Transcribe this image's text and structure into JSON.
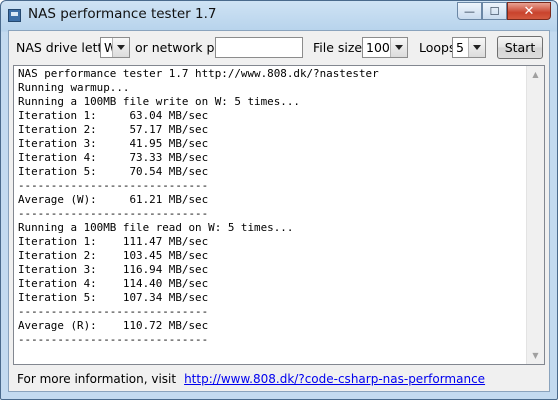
{
  "window": {
    "title": "NAS performance tester 1.7",
    "controls": {
      "minimize": "—",
      "maximize": "☐",
      "close": "✕"
    }
  },
  "toolbar": {
    "drive_label": "NAS drive letter",
    "drive_value": "W",
    "network_label": "or network path",
    "network_path_value": "",
    "filesize_label": "File size",
    "filesize_value": "100",
    "loops_label": "Loops",
    "loops_value": "5",
    "start_label": "Start"
  },
  "output": {
    "lines": [
      "NAS performance tester 1.7 http://www.808.dk/?nastester",
      "Running warmup...",
      "Running a 100MB file write on W: 5 times...",
      "Iteration 1:     63.04 MB/sec",
      "Iteration 2:     57.17 MB/sec",
      "Iteration 3:     41.95 MB/sec",
      "Iteration 4:     73.33 MB/sec",
      "Iteration 5:     70.54 MB/sec",
      "-----------------------------",
      "Average (W):     61.21 MB/sec",
      "-----------------------------",
      "Running a 100MB file read on W: 5 times...",
      "Iteration 1:    111.47 MB/sec",
      "Iteration 2:    103.45 MB/sec",
      "Iteration 3:    116.94 MB/sec",
      "Iteration 4:    114.40 MB/sec",
      "Iteration 5:    107.34 MB/sec",
      "-----------------------------",
      "Average (R):    110.72 MB/sec",
      "-----------------------------"
    ]
  },
  "footer": {
    "info_text": "For more information, visit",
    "link_text": "http://www.808.dk/?code-csharp-nas-performance"
  },
  "colors": {
    "link": "#0000ee",
    "title_bar": "#b7d3ec",
    "close_button": "#c9432d"
  }
}
